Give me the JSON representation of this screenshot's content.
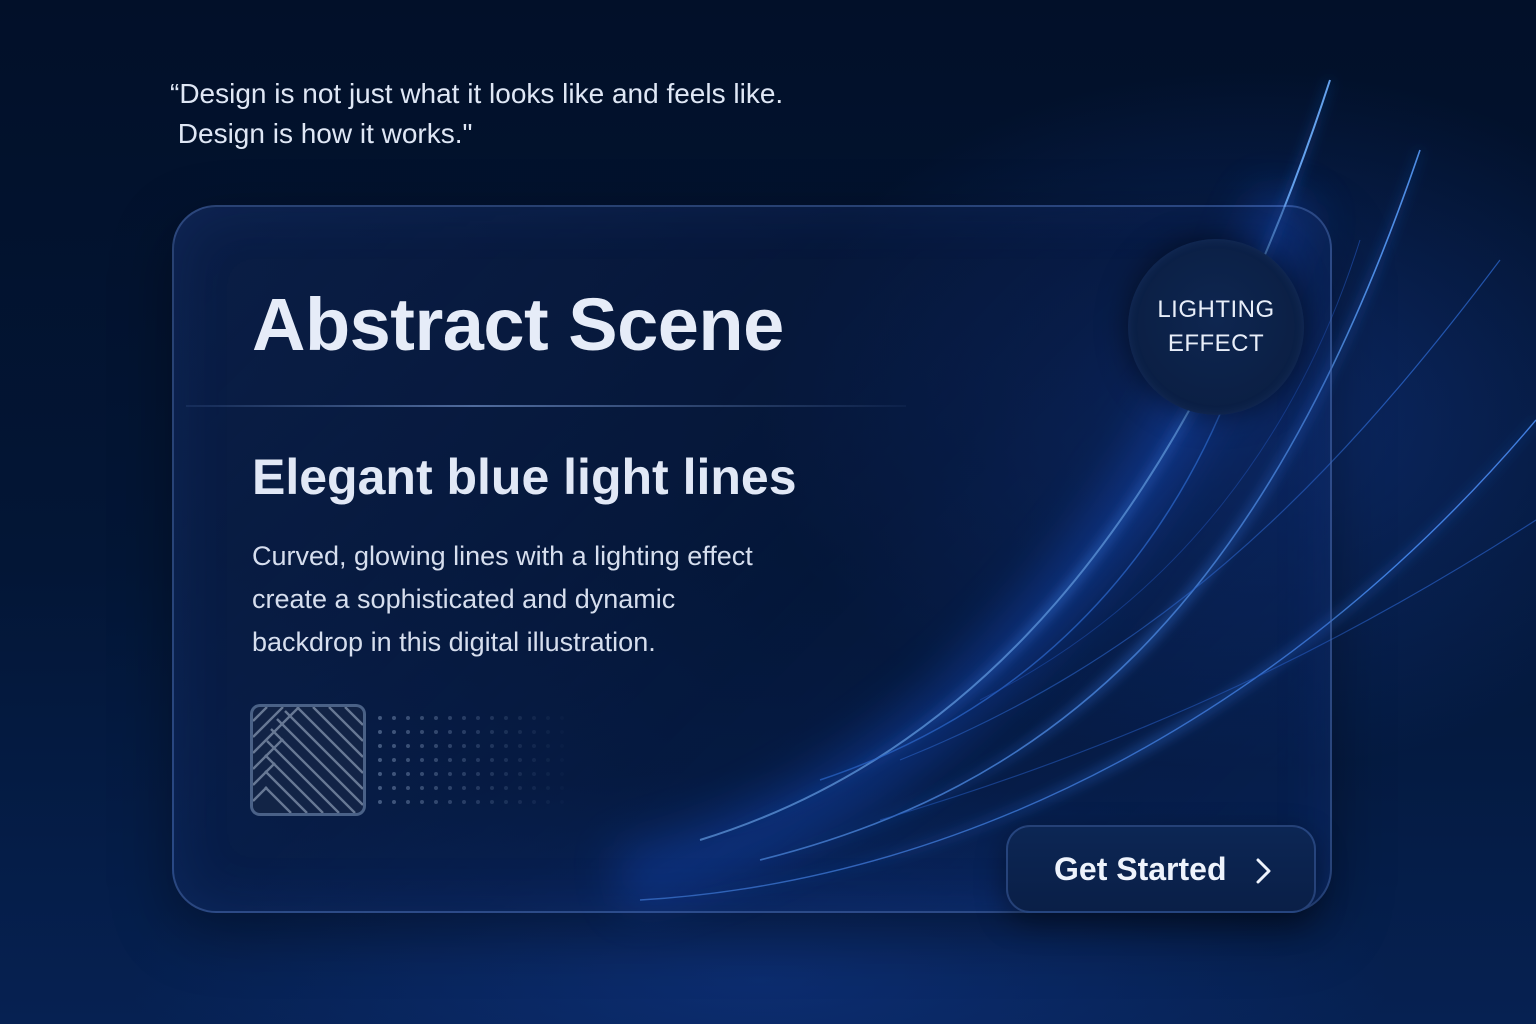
{
  "quote": {
    "line1": "“Design is not just what it looks like and feels like.",
    "line2": " Design is how it works.\""
  },
  "card": {
    "title": "Abstract Scene",
    "subtitle": "Elegant blue light lines",
    "description": [
      "Curved, glowing lines with a lighting effect",
      "create a sophisticated and dynamic",
      "backdrop in this digital illustration."
    ]
  },
  "badge": {
    "line1": "LIGHTING",
    "line2": "EFFECT"
  },
  "cta": {
    "label": "Get Started",
    "icon": "chevron-right-icon"
  },
  "colors": {
    "background": "#020d24",
    "accent": "#2f7bff",
    "text": "#e6ecf8"
  }
}
